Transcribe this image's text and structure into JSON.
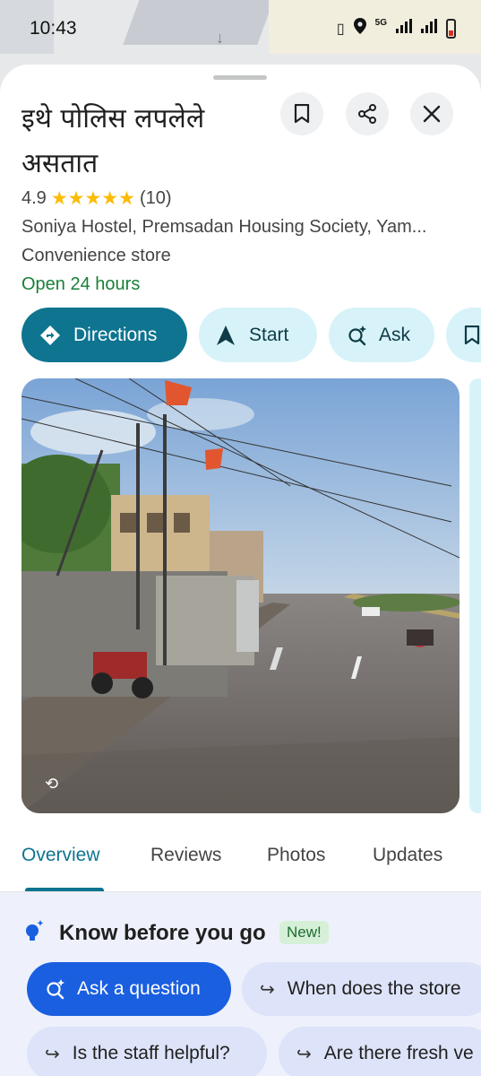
{
  "status_bar": {
    "time": "10:43",
    "network": "5G"
  },
  "place": {
    "title": "इथे पोलिस लपलेले असतात",
    "rating": "4.9",
    "stars": "★★★★★",
    "review_count": "(10)",
    "address": "Soniya Hostel, Premsadan Housing Society, Yam...",
    "category": "Convenience store",
    "hours": "Open 24 hours"
  },
  "actions": [
    {
      "label": "Directions",
      "icon": "directions-icon"
    },
    {
      "label": "Start",
      "icon": "navigation-arrow-icon"
    },
    {
      "label": "Ask",
      "icon": "ask-sparkle-icon"
    },
    {
      "label": "",
      "icon": "bookmark-icon"
    }
  ],
  "tabs": [
    "Overview",
    "Reviews",
    "Photos",
    "Updates"
  ],
  "active_tab": "Overview",
  "know_before": {
    "title": "Know before you go",
    "badge": "New!",
    "questions": [
      {
        "label": "Ask a question",
        "primary": true
      },
      {
        "label": "When does the store",
        "primary": false
      },
      {
        "label": "Is the staff helpful?",
        "primary": false
      },
      {
        "label": "Are there fresh ve",
        "primary": false
      }
    ]
  },
  "colors": {
    "accent": "#0e7490",
    "open_green": "#188038",
    "star": "#fbbc04",
    "ask_blue": "#1a5fe0"
  }
}
